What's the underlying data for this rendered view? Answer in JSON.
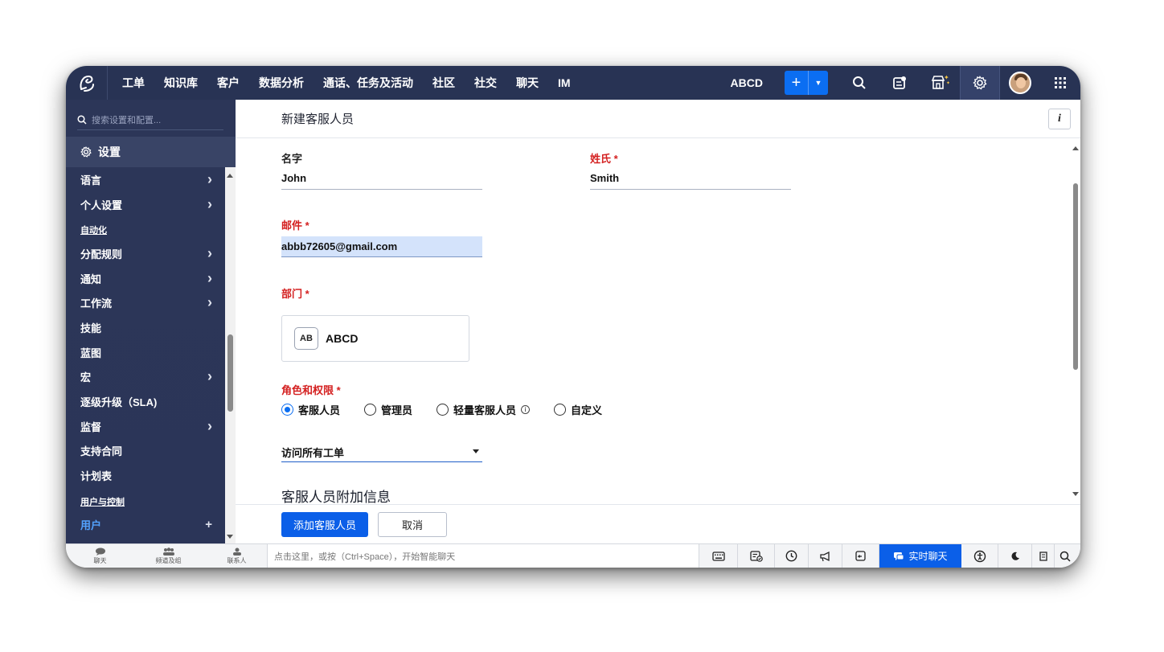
{
  "topnav": {
    "items": [
      "工单",
      "知识库",
      "客户",
      "数据分析",
      "通话、任务及活动",
      "社区",
      "社交",
      "聊天",
      "IM"
    ],
    "department": "ABCD",
    "plus_label": "+"
  },
  "sidebar": {
    "search_placeholder": "搜索设置和配置...",
    "settings_label": "设置",
    "items": [
      {
        "label": "语言",
        "chevron": true
      },
      {
        "label": "个人设置",
        "chevron": true
      },
      {
        "section": "自动化"
      },
      {
        "label": "分配规则",
        "chevron": true
      },
      {
        "label": "通知",
        "chevron": true
      },
      {
        "label": "工作流",
        "chevron": true
      },
      {
        "label": "技能",
        "chevron": false
      },
      {
        "label": "蓝图",
        "chevron": false
      },
      {
        "label": "宏",
        "chevron": true
      },
      {
        "label": "逐级升级（SLA)",
        "chevron": false
      },
      {
        "label": "监督",
        "chevron": true
      },
      {
        "label": "支持合同",
        "chevron": false
      },
      {
        "label": "计划表",
        "chevron": false
      },
      {
        "section": "用户与控制"
      },
      {
        "label": "用户",
        "plus": true,
        "active": true
      }
    ]
  },
  "main": {
    "title": "新建客服人员",
    "info_label": "i",
    "first_name_label": "名字",
    "first_name_value": "John",
    "last_name_label": "姓氏 *",
    "last_name_value": "Smith",
    "email_label": "邮件 *",
    "email_value": "abbb72605@gmail.com",
    "department_label": "部门 *",
    "department_badge": "AB",
    "department_name": "ABCD",
    "role_label": "角色和权限 *",
    "roles": [
      {
        "label": "客服人员",
        "checked": true
      },
      {
        "label": "管理员",
        "checked": false
      },
      {
        "label": "轻量客服人员",
        "checked": false,
        "info": true
      },
      {
        "label": "自定义",
        "checked": false
      }
    ],
    "access_value": "访问所有工单",
    "additional_info_title": "客服人员附加信息",
    "add_button": "添加客服人员",
    "cancel_button": "取消"
  },
  "bottombar": {
    "tabs": [
      "聊天",
      "频道及组",
      "联系人"
    ],
    "input_placeholder": "点击这里，或按（Ctrl+Space），开始智能聊天",
    "live_chat": "实时聊天"
  },
  "colors": {
    "nav_bg": "#283354",
    "accent": "#0b5fe8",
    "required": "#d42020"
  }
}
